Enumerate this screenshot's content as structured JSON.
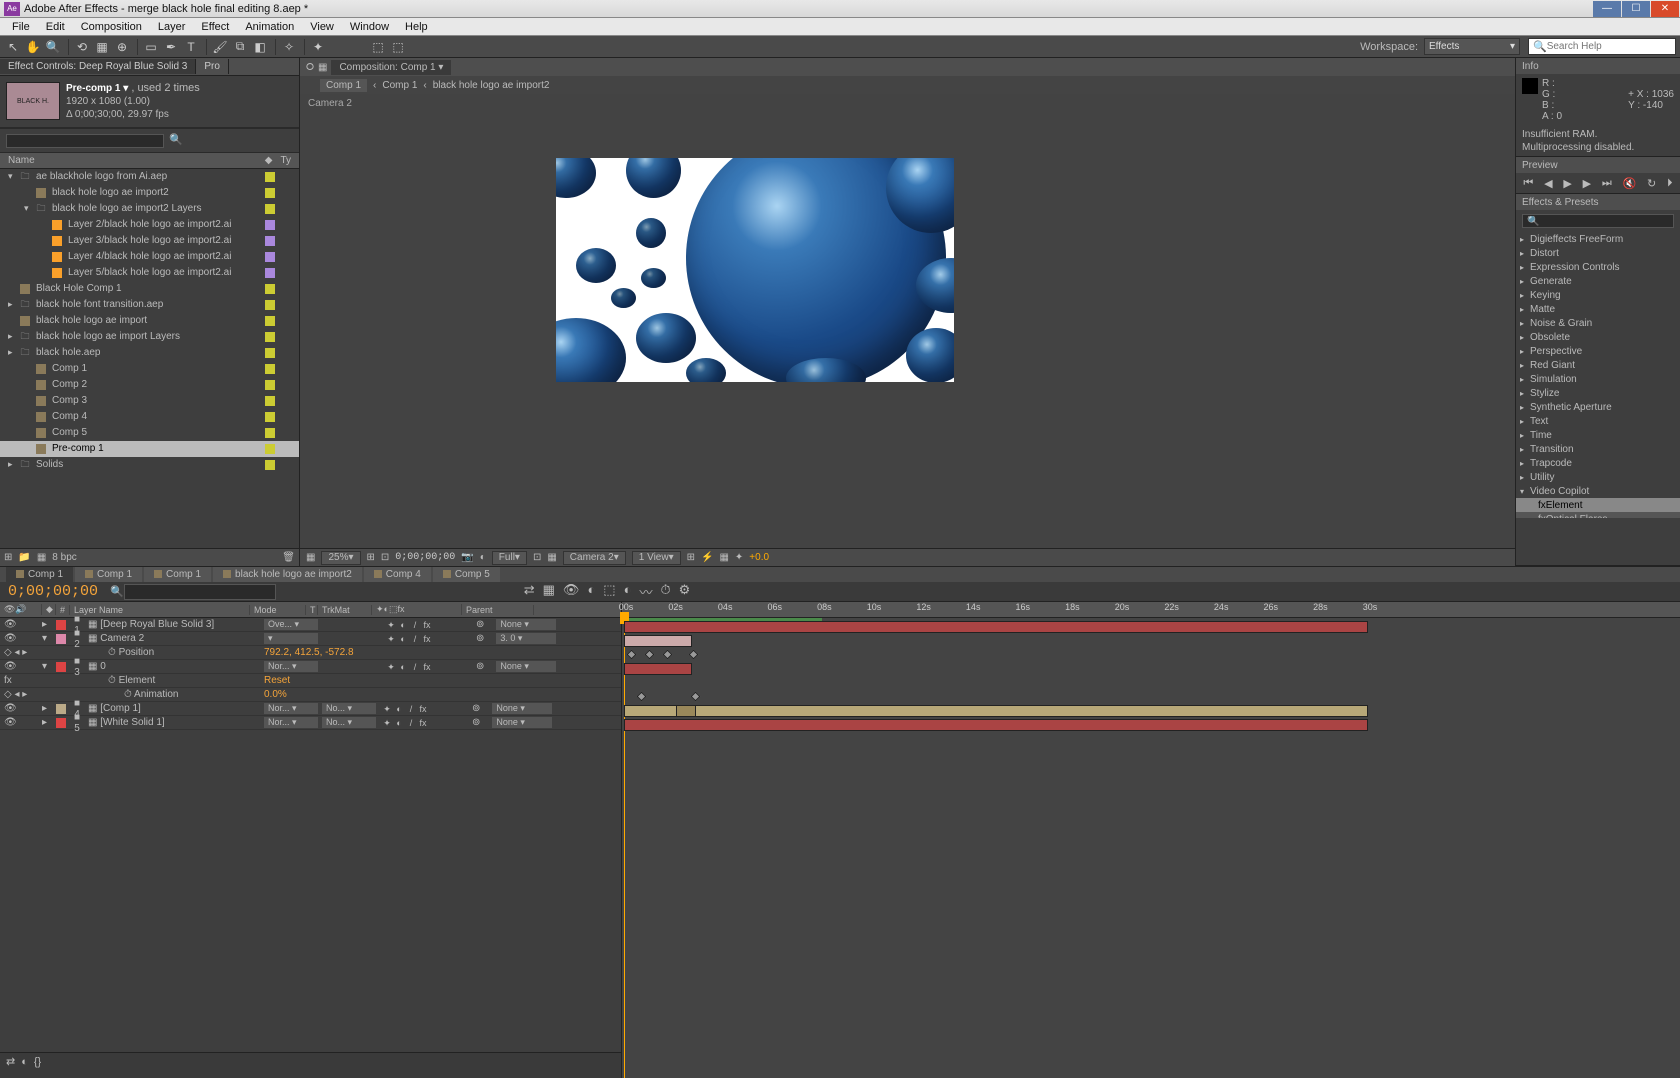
{
  "titlebar": {
    "app_icon_text": "Ae",
    "title": "Adobe After Effects - merge black hole final editing 8.aep *"
  },
  "menubar": [
    "File",
    "Edit",
    "Composition",
    "Layer",
    "Effect",
    "Animation",
    "View",
    "Window",
    "Help"
  ],
  "toolbar": {
    "workspace_label": "Workspace:",
    "workspace_value": "Effects",
    "search_placeholder": "Search Help"
  },
  "project_panel": {
    "tab_effect_controls": "Effect Controls: Deep Royal Blue Solid 3",
    "tab_project": "Pro",
    "selected_name": "Pre-comp 1 ▾",
    "selected_used": ", used 2 times",
    "selected_dims": "1920 x 1080 (1.00)",
    "selected_dur": "Δ 0;00;30;00, 29.97 fps",
    "header_name": "Name",
    "header_type": "Ty",
    "items": [
      {
        "level": 0,
        "open": true,
        "icon": "folder",
        "label": "ae blackhole logo from Ai.aep",
        "color": "#cc3"
      },
      {
        "level": 1,
        "open": false,
        "icon": "comp",
        "label": "black hole logo ae import2",
        "color": "#cc3"
      },
      {
        "level": 1,
        "open": true,
        "icon": "folder",
        "label": "black hole logo ae import2 Layers",
        "color": "#cc3"
      },
      {
        "level": 2,
        "open": false,
        "icon": "ai",
        "label": "Layer 2/black hole logo ae import2.ai",
        "color": "#a8d"
      },
      {
        "level": 2,
        "open": false,
        "icon": "ai",
        "label": "Layer 3/black hole logo ae import2.ai",
        "color": "#a8d"
      },
      {
        "level": 2,
        "open": false,
        "icon": "ai",
        "label": "Layer 4/black hole logo ae import2.ai",
        "color": "#a8d"
      },
      {
        "level": 2,
        "open": false,
        "icon": "ai",
        "label": "Layer 5/black hole logo ae import2.ai",
        "color": "#a8d"
      },
      {
        "level": 0,
        "open": false,
        "icon": "comp",
        "label": "Black Hole Comp 1",
        "color": "#cc3"
      },
      {
        "level": 0,
        "open": false,
        "icon": "folder",
        "label": "black hole font transition.aep",
        "color": "#cc3"
      },
      {
        "level": 0,
        "open": false,
        "icon": "comp",
        "label": "black hole logo ae import",
        "color": "#cc3"
      },
      {
        "level": 0,
        "open": false,
        "icon": "folder",
        "label": "black hole logo ae import Layers",
        "color": "#cc3"
      },
      {
        "level": 0,
        "open": false,
        "icon": "folder",
        "label": "black hole.aep",
        "color": "#cc3"
      },
      {
        "level": 1,
        "open": false,
        "icon": "comp",
        "label": "Comp 1",
        "color": "#cc3"
      },
      {
        "level": 1,
        "open": false,
        "icon": "comp",
        "label": "Comp 2",
        "color": "#cc3"
      },
      {
        "level": 1,
        "open": false,
        "icon": "comp",
        "label": "Comp 3",
        "color": "#cc3"
      },
      {
        "level": 1,
        "open": false,
        "icon": "comp",
        "label": "Comp 4",
        "color": "#cc3"
      },
      {
        "level": 1,
        "open": false,
        "icon": "comp",
        "label": "Comp 5",
        "color": "#cc3"
      },
      {
        "level": 1,
        "open": false,
        "icon": "comp",
        "label": "Pre-comp 1",
        "color": "#cc3",
        "selected": true
      },
      {
        "level": 0,
        "open": false,
        "icon": "folder",
        "label": "Solids",
        "color": "#cc3"
      }
    ],
    "footer_bpc": "8 bpc"
  },
  "viewer": {
    "tab_prefix": "Composition:",
    "tab_name": "Comp 1 ▾",
    "breadcrumbs": [
      "Comp 1",
      "‹",
      "Comp 1",
      "‹",
      "black hole logo ae import2"
    ],
    "camera_label": "Camera 2",
    "zoom": "25%",
    "timecode": "0;00;00;00",
    "res": "Full",
    "view_camera": "Camera 2",
    "view_count": "1 View",
    "exposure": "+0.0"
  },
  "info": {
    "title": "Info",
    "R": "R :",
    "G": "G :",
    "B": "B :",
    "A": "A :  0",
    "X": "X : 1036",
    "Y": "Y : -140",
    "status1": "Insufficient RAM.",
    "status2": "Multiprocessing disabled."
  },
  "preview": {
    "title": "Preview"
  },
  "effects_presets": {
    "title": "Effects & Presets",
    "categories": [
      "Digieffects FreeForm",
      "Distort",
      "Expression Controls",
      "Generate",
      "Keying",
      "Matte",
      "Noise & Grain",
      "Obsolete",
      "Perspective",
      "Red Giant",
      "Simulation",
      "Stylize",
      "Synthetic Aperture",
      "Text",
      "Time",
      "Transition",
      "Trapcode",
      "Utility"
    ],
    "open_cat": "Video Copilot",
    "sub_items": [
      "Element",
      "Optical Flares"
    ],
    "selected_sub": 0
  },
  "timeline": {
    "tabs": [
      "Comp 1",
      "Comp 1",
      "Comp 1",
      "black hole logo ae import2",
      "Comp 4",
      "Comp 5"
    ],
    "active_tab": 0,
    "timecode": "0;00;00;00",
    "columns": {
      "layername": "Layer Name",
      "mode": "Mode",
      "t": "T",
      "trkmat": "TrkMat",
      "parent": "Parent"
    },
    "ruler_ticks": [
      "00s",
      "02s",
      "04s",
      "06s",
      "08s",
      "10s",
      "12s",
      "14s",
      "16s",
      "18s",
      "20s",
      "22s",
      "24s",
      "26s",
      "28s",
      "30s"
    ],
    "layers": [
      {
        "num": "1",
        "color": "#d44",
        "name": "[Deep Royal Blue Solid 3]",
        "mode": "Ove...",
        "parent": "None",
        "bar": "red",
        "indent": 0
      },
      {
        "num": "2",
        "color": "#d8a",
        "name": "Camera 2",
        "mode": "",
        "parent": "3. 0",
        "bar": "pink",
        "indent": 0,
        "open": true
      },
      {
        "num": "",
        "color": "",
        "name": "Position",
        "value": "792.2, 412.5, -572.8",
        "indent": 1,
        "kf": true
      },
      {
        "num": "3",
        "color": "#d44",
        "name": "0",
        "mode": "Nor...",
        "parent": "None",
        "bar": "red",
        "indent": 0,
        "open": true
      },
      {
        "num": "",
        "color": "",
        "name": "Element",
        "value": "Reset",
        "indent": 1
      },
      {
        "num": "",
        "color": "",
        "name": "Animation",
        "value": "0.0%",
        "indent": 2,
        "kf": true
      },
      {
        "num": "4",
        "color": "#ba8",
        "name": "[Comp 1]",
        "mode": "Nor...",
        "trkmat": "No...",
        "parent": "None",
        "bar": "tan",
        "indent": 0
      },
      {
        "num": "5",
        "color": "#d44",
        "name": "[White Solid 1]",
        "mode": "Nor...",
        "trkmat": "No...",
        "parent": "None",
        "bar": "red",
        "indent": 0
      }
    ]
  }
}
